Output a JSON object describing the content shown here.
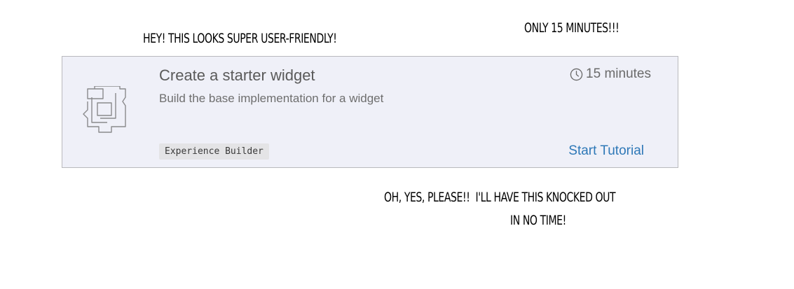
{
  "annotations": {
    "top_left": "Hey! This looks super user-friendly!",
    "top_right": "Only 15 minutes!!!",
    "bottom_line1_left": "Oh, yes, please!!",
    "bottom_line1_right": "I'll have this knocked out",
    "bottom_line2": "in no time!"
  },
  "card": {
    "icon": "widget-bracket-icon",
    "title": "Create a starter widget",
    "subtitle": "Build the base implementation for a widget",
    "duration_icon": "clock-icon",
    "duration": "15 minutes",
    "tag": "Experience Builder",
    "action_label": "Start Tutorial",
    "colors": {
      "background": "#eff0f8",
      "border": "#b9b9bd",
      "link": "#2e78b7"
    }
  }
}
